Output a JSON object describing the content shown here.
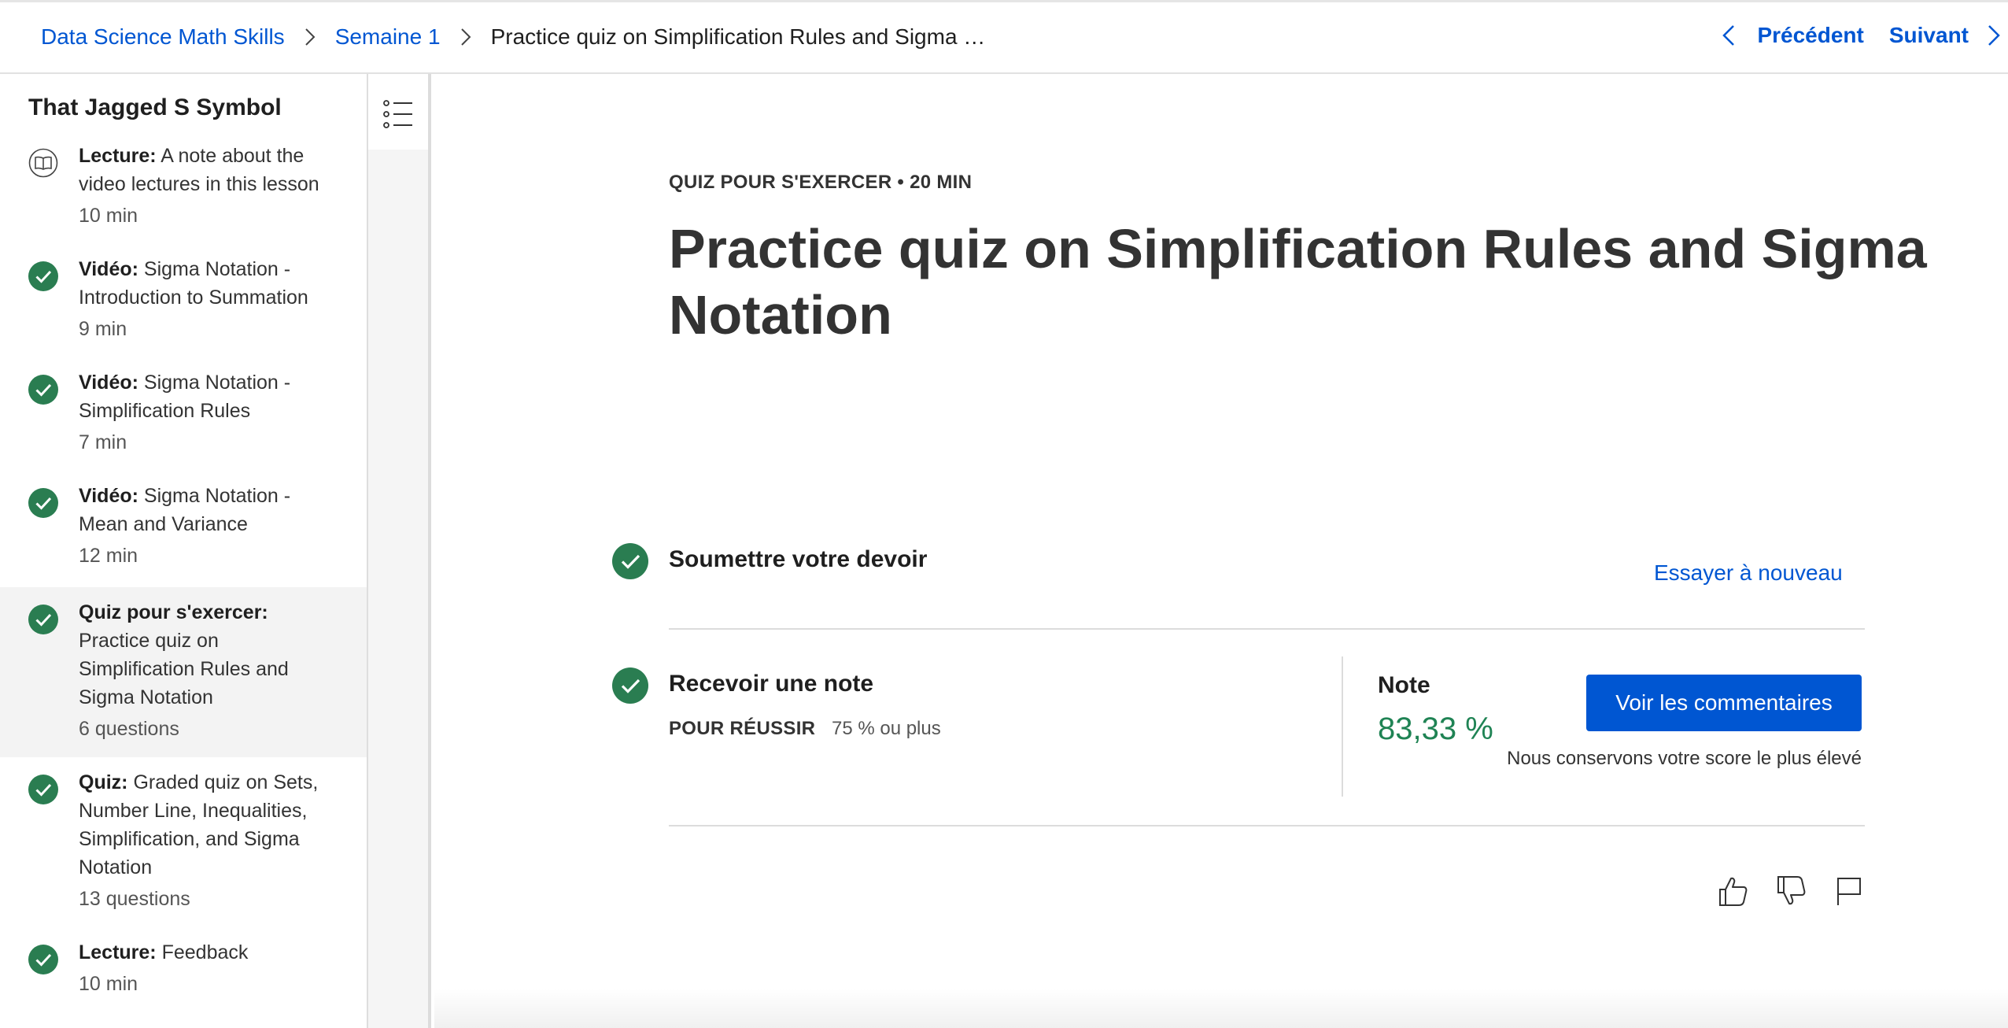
{
  "header": {
    "breadcrumbs": [
      {
        "label": "Data Science Math Skills"
      },
      {
        "label": "Semaine 1"
      },
      {
        "label": "Practice quiz on Simplification Rules and Sigma …"
      }
    ],
    "prev_label": "Précédent",
    "next_label": "Suivant"
  },
  "sidebar": {
    "module_title": "That Jagged S Symbol",
    "items": [
      {
        "type": "Lecture:",
        "title": "A note about the video lectures in this lesson",
        "meta": "10 min",
        "icon": "book-icon",
        "completed": false
      },
      {
        "type": "Vidéo:",
        "title": "Sigma Notation - Introduction to Summation",
        "meta": "9 min",
        "icon": "check-circle-icon",
        "completed": true
      },
      {
        "type": "Vidéo:",
        "title": "Sigma Notation - Simplification Rules",
        "meta": "7 min",
        "icon": "check-circle-icon",
        "completed": true
      },
      {
        "type": "Vidéo:",
        "title": "Sigma Notation - Mean and Variance",
        "meta": "12 min",
        "icon": "check-circle-icon",
        "completed": true
      },
      {
        "type": "Quiz pour s'exercer:",
        "title": "Practice quiz on Simplification Rules and Sigma Notation",
        "meta": "6 questions",
        "icon": "check-circle-icon",
        "completed": true,
        "active": true
      },
      {
        "type": "Quiz:",
        "title": "Graded quiz on Sets, Number Line, Inequalities, Simplification, and Sigma Notation",
        "meta": "13 questions",
        "icon": "check-circle-icon",
        "completed": true
      },
      {
        "type": "Lecture:",
        "title": "Feedback",
        "meta": "10 min",
        "icon": "check-circle-icon",
        "completed": true
      }
    ]
  },
  "main": {
    "kicker": "QUIZ POUR S'EXERCER • 20 MIN",
    "title": "Practice quiz on Simplification Rules and Sigma Notation",
    "submit_step": "Soumettre votre devoir",
    "retry_label": "Essayer à nouveau",
    "grade_step": "Recevoir une note",
    "pass_label": "POUR RÉUSSIR",
    "pass_value": "75 % ou plus",
    "grade_label": "Note",
    "grade_value": "83,33 %",
    "feedback_button": "Voir les commentaires",
    "keep_note": "Nous conservons votre score le plus élevé"
  },
  "colors": {
    "accent": "#0056d2",
    "success": "#1f8354",
    "check_bg": "#2a7d51"
  }
}
